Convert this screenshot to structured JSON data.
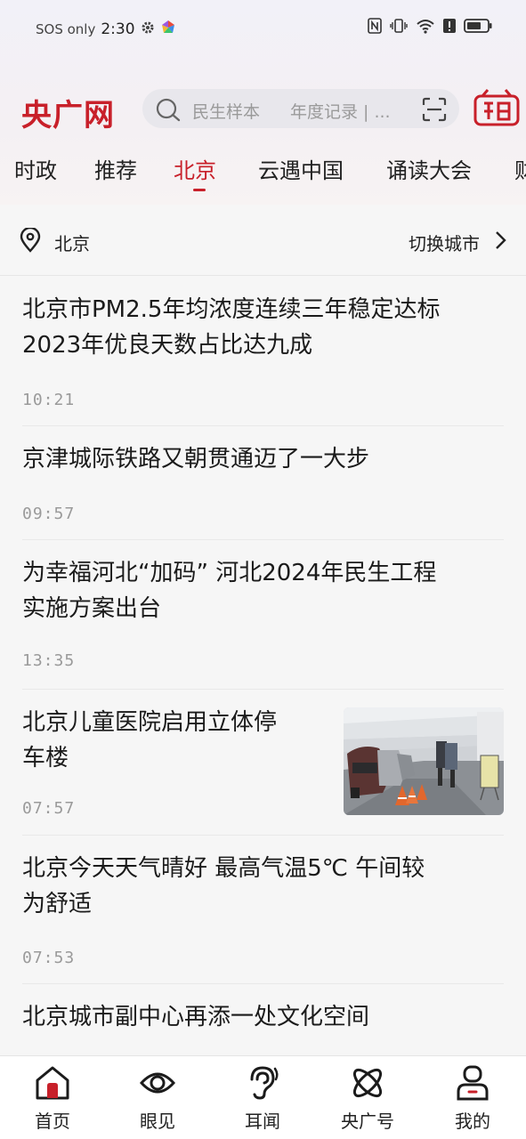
{
  "status": {
    "sos": "SOS only",
    "time": "2:30"
  },
  "header": {
    "logo": "央广网",
    "search_placeholder_1": "民生样本",
    "search_placeholder_2": "年度记录 | ..."
  },
  "tabs": [
    {
      "label": "时政"
    },
    {
      "label": "推荐"
    },
    {
      "label": "北京",
      "active": true
    },
    {
      "label": "云遇中国"
    },
    {
      "label": "诵读大会"
    },
    {
      "label": "财"
    }
  ],
  "location": {
    "city": "北京",
    "switch_label": "切换城市"
  },
  "news": [
    {
      "title_line1": "北京市PM2.5年均浓度连续三年稳定达标",
      "title_line2": "2023年优良天数占比达九成",
      "time": "10:21"
    },
    {
      "title_line1": "京津城际铁路又朝贯通迈了一大步",
      "title_line2": "",
      "time": "09:57"
    },
    {
      "title_line1": "为幸福河北“加码” 河北2024年民生工程",
      "title_line2": "实施方案出台",
      "time": "13:35"
    },
    {
      "title_line1": "北京儿童医院启用立体停",
      "title_line2": "车楼",
      "time": "07:57",
      "has_image": true
    },
    {
      "title_line1": "北京今天天气晴好  最高气温5℃  午间较",
      "title_line2": "为舒适",
      "time": "07:53"
    },
    {
      "title_line1": "北京城市副中心再添一处文化空间",
      "title_line2": "",
      "time": ""
    }
  ],
  "bottom_nav": [
    {
      "label": "首页",
      "icon": "home-icon"
    },
    {
      "label": "眼见",
      "icon": "eye-icon"
    },
    {
      "label": "耳闻",
      "icon": "ear-icon"
    },
    {
      "label": "央广号",
      "icon": "atom-icon"
    },
    {
      "label": "我的",
      "icon": "user-icon"
    }
  ],
  "colors": {
    "accent": "#c8202a",
    "text": "#1b1b1b",
    "muted": "#9a9a9a"
  }
}
